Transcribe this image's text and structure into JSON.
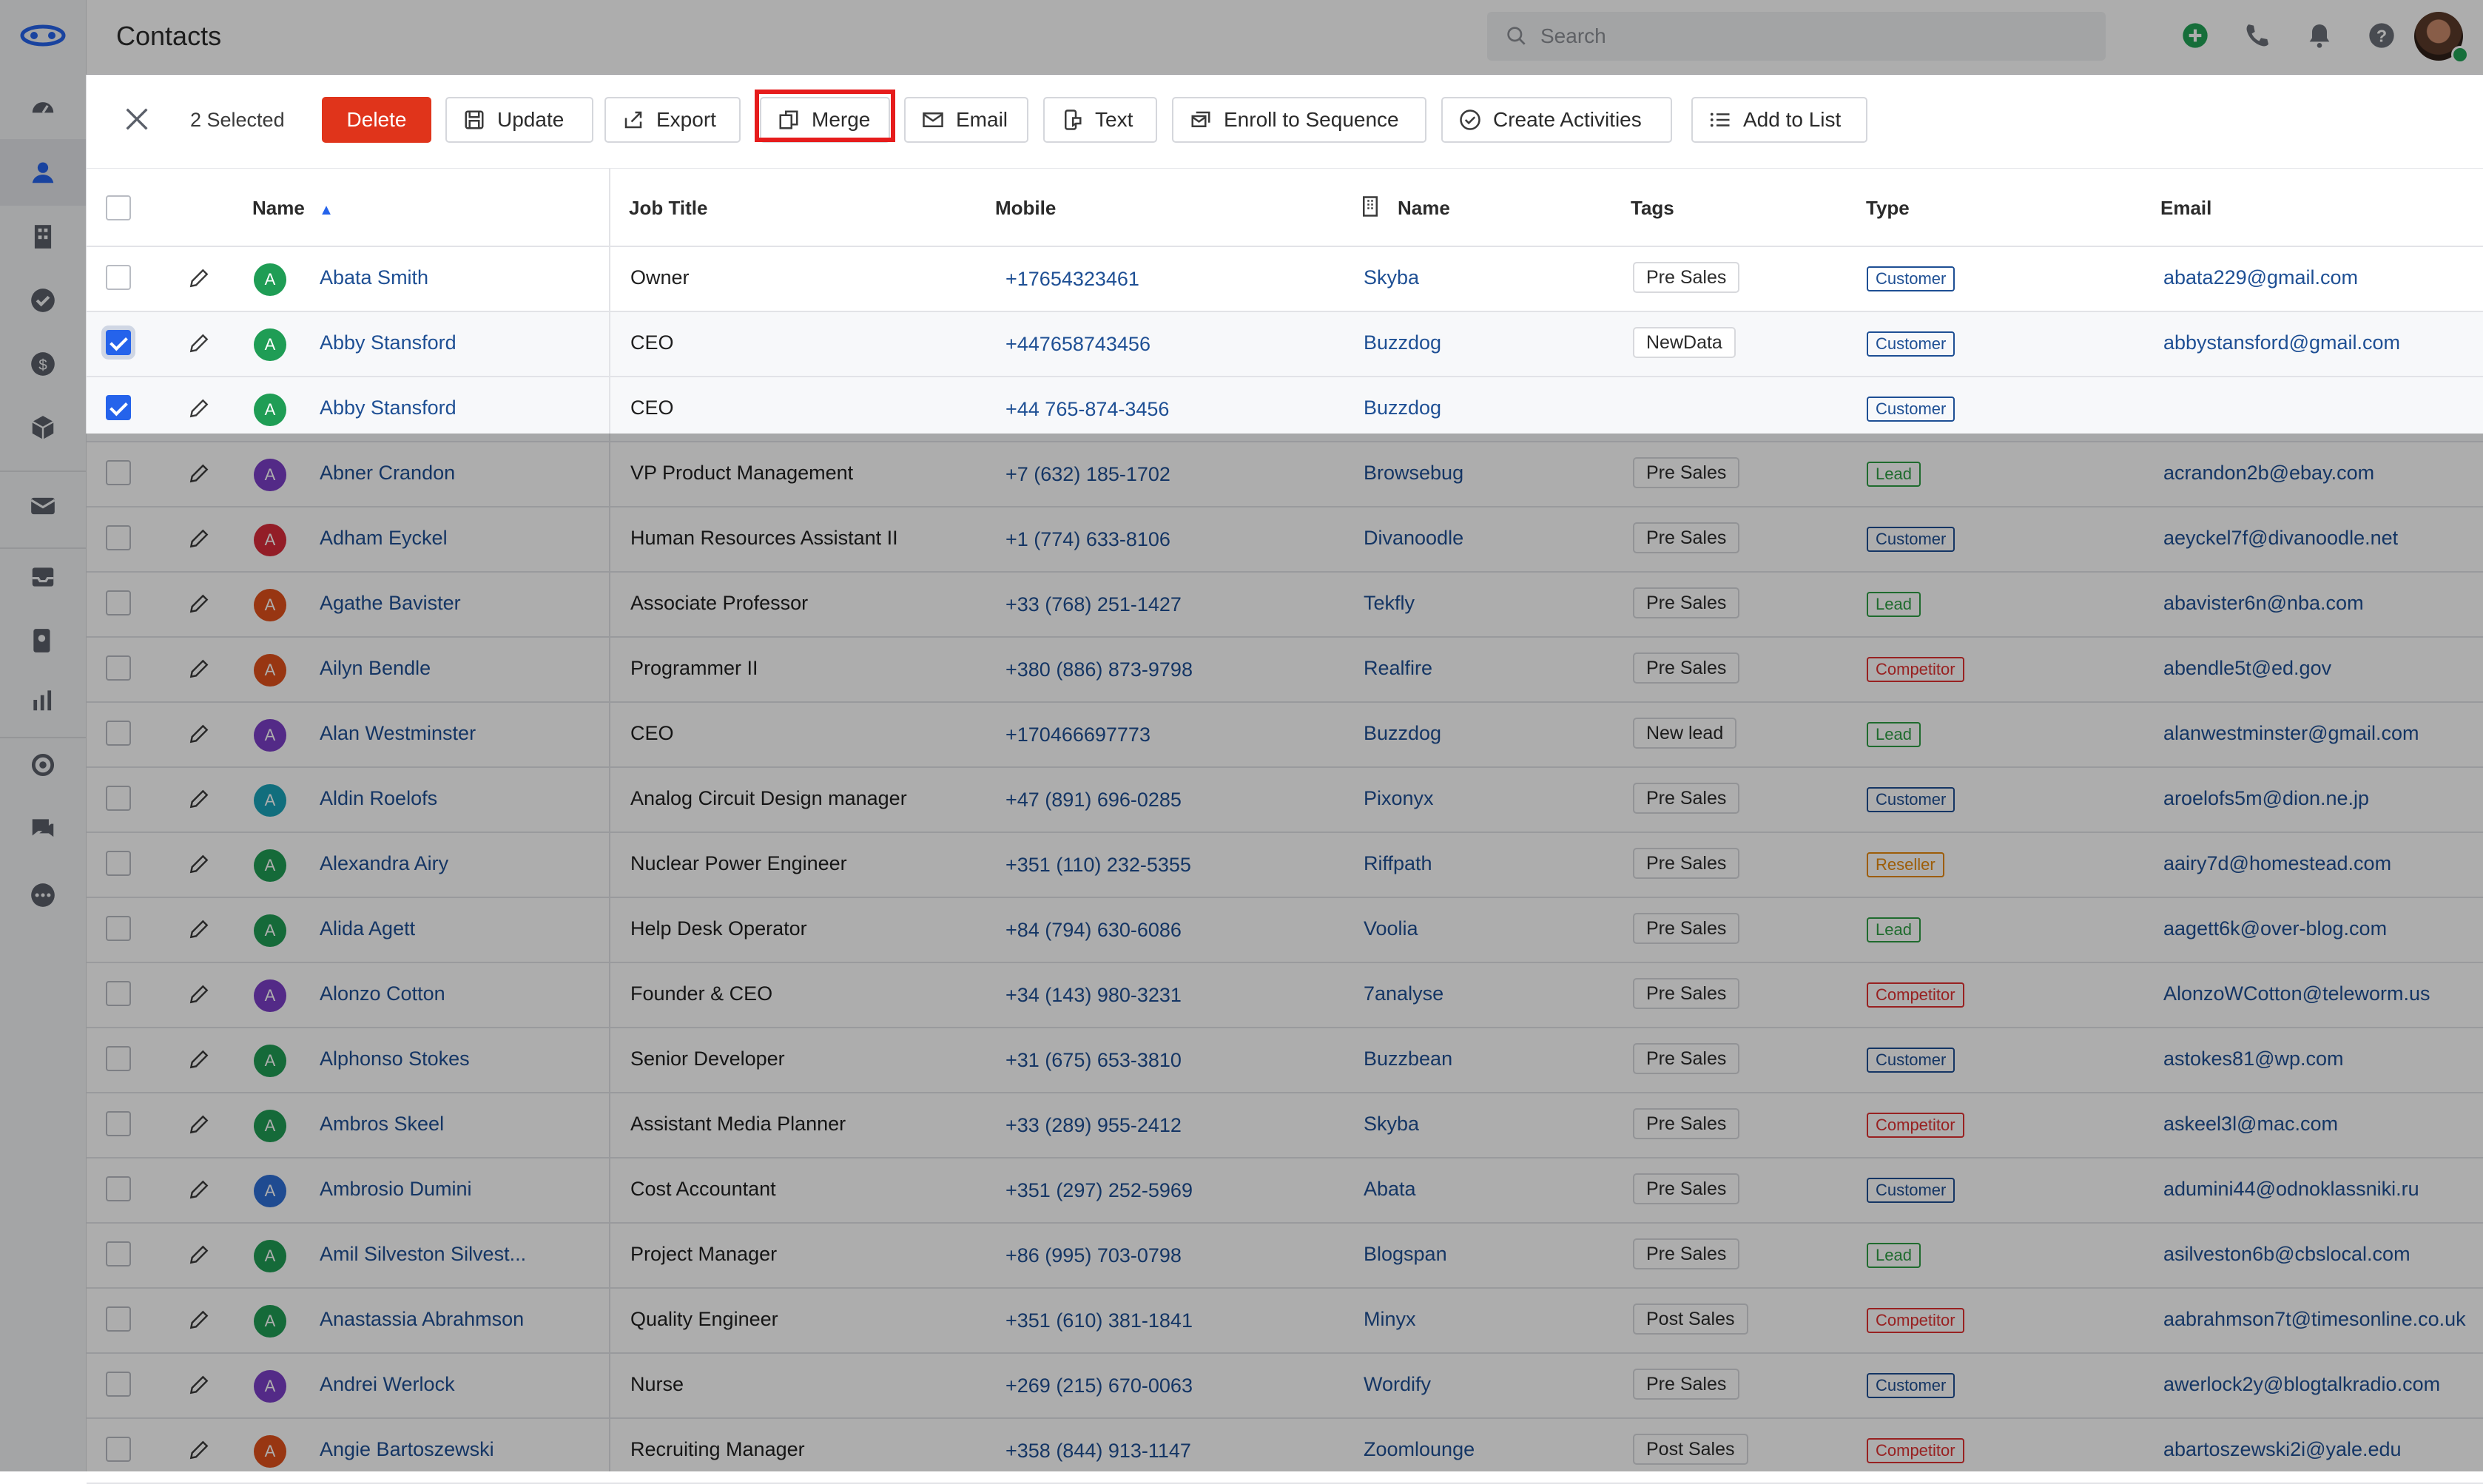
{
  "page": {
    "title": "Contacts"
  },
  "search": {
    "placeholder": "Search"
  },
  "actionbar": {
    "selected_label": "2 Selected",
    "buttons": {
      "delete": "Delete",
      "update": "Update",
      "export": "Export",
      "merge": "Merge",
      "email": "Email",
      "text": "Text",
      "enroll": "Enroll to Sequence",
      "create_activities": "Create Activities",
      "add_to_list": "Add to List"
    }
  },
  "table": {
    "headers": {
      "name": "Name",
      "job_title": "Job Title",
      "mobile": "Mobile",
      "company_name": "Name",
      "tags": "Tags",
      "type": "Type",
      "email": "Email"
    },
    "rows": [
      {
        "checked": false,
        "name": "Abata Smith",
        "avatar": "A",
        "avatar_color": "#1f9d55",
        "job": "Owner",
        "mobile": "+17654323461",
        "company": "Skyba",
        "tag": "Pre Sales",
        "type": "Customer",
        "email": "abata229@gmail.com"
      },
      {
        "checked": true,
        "name": "Abby Stansford",
        "avatar": "A",
        "avatar_color": "#1f9d55",
        "job": "CEO",
        "mobile": "+447658743456",
        "company": "Buzzdog",
        "tag": "NewData",
        "type": "Customer",
        "email": "abbystansford@gmail.com"
      },
      {
        "checked": true,
        "name": "Abby Stansford",
        "avatar": "A",
        "avatar_color": "#1f9d55",
        "job": "CEO",
        "mobile": "+44 765-874-3456",
        "company": "Buzzdog",
        "tag": "",
        "type": "Customer",
        "email": ""
      },
      {
        "checked": false,
        "name": "Abner Crandon",
        "avatar": "A",
        "avatar_color": "#7b3fc7",
        "job": "VP Product Management",
        "mobile": "+7 (632) 185-1702",
        "company": "Browsebug",
        "tag": "Pre Sales",
        "type": "Lead",
        "email": "acrandon2b@ebay.com"
      },
      {
        "checked": false,
        "name": "Adham Eyckel",
        "avatar": "A",
        "avatar_color": "#d92b3a",
        "job": "Human Resources Assistant II",
        "mobile": "+1 (774) 633-8106",
        "company": "Divanoodle",
        "tag": "Pre Sales",
        "type": "Customer",
        "email": "aeyckel7f@divanoodle.net"
      },
      {
        "checked": false,
        "name": "Agathe Bavister",
        "avatar": "A",
        "avatar_color": "#e0501b",
        "job": "Associate Professor",
        "mobile": "+33 (768) 251-1427",
        "company": "Tekfly",
        "tag": "Pre Sales",
        "type": "Lead",
        "email": "abavister6n@nba.com"
      },
      {
        "checked": false,
        "name": "Ailyn Bendle",
        "avatar": "A",
        "avatar_color": "#e0501b",
        "job": "Programmer II",
        "mobile": "+380 (886) 873-9798",
        "company": "Realfire",
        "tag": "Pre Sales",
        "type": "Competitor",
        "email": "abendle5t@ed.gov"
      },
      {
        "checked": false,
        "name": "Alan Westminster",
        "avatar": "A",
        "avatar_color": "#7b3fc7",
        "job": "CEO",
        "mobile": "+170466697773",
        "company": "Buzzdog",
        "tag": "New lead",
        "type": "Lead",
        "email": "alanwestminster@gmail.com"
      },
      {
        "checked": false,
        "name": "Aldin Roelofs",
        "avatar": "A",
        "avatar_color": "#1aa3b8",
        "job": "Analog Circuit Design manager",
        "mobile": "+47 (891) 696-0285",
        "company": "Pixonyx",
        "tag": "Pre Sales",
        "type": "Customer",
        "email": "aroelofs5m@dion.ne.jp"
      },
      {
        "checked": false,
        "name": "Alexandra Airy",
        "avatar": "A",
        "avatar_color": "#1f9d55",
        "job": "Nuclear Power Engineer",
        "mobile": "+351 (110) 232-5355",
        "company": "Riffpath",
        "tag": "Pre Sales",
        "type": "Reseller",
        "email": "aairy7d@homestead.com"
      },
      {
        "checked": false,
        "name": "Alida Agett",
        "avatar": "A",
        "avatar_color": "#1f9d55",
        "job": "Help Desk Operator",
        "mobile": "+84 (794) 630-6086",
        "company": "Voolia",
        "tag": "Pre Sales",
        "type": "Lead",
        "email": "aagett6k@over-blog.com"
      },
      {
        "checked": false,
        "name": "Alonzo Cotton",
        "avatar": "A",
        "avatar_color": "#7b3fc7",
        "job": "Founder & CEO",
        "mobile": "+34 (143) 980-3231",
        "company": "7analyse",
        "tag": "Pre Sales",
        "type": "Competitor",
        "email": "AlonzoWCotton@teleworm.us"
      },
      {
        "checked": false,
        "name": "Alphonso Stokes",
        "avatar": "A",
        "avatar_color": "#1f9d55",
        "job": "Senior Developer",
        "mobile": "+31 (675) 653-3810",
        "company": "Buzzbean",
        "tag": "Pre Sales",
        "type": "Customer",
        "email": "astokes81@wp.com"
      },
      {
        "checked": false,
        "name": "Ambros Skeel",
        "avatar": "A",
        "avatar_color": "#1f9d55",
        "job": "Assistant Media Planner",
        "mobile": "+33 (289) 955-2412",
        "company": "Skyba",
        "tag": "Pre Sales",
        "type": "Competitor",
        "email": "askeel3l@mac.com"
      },
      {
        "checked": false,
        "name": "Ambrosio Dumini",
        "avatar": "A",
        "avatar_color": "#2f6fd6",
        "job": "Cost Accountant",
        "mobile": "+351 (297) 252-5969",
        "company": "Abata",
        "tag": "Pre Sales",
        "type": "Customer",
        "email": "adumini44@odnoklassniki.ru"
      },
      {
        "checked": false,
        "name": "Amil Silveston Silvest...",
        "avatar": "A",
        "avatar_color": "#1f9d55",
        "job": "Project Manager",
        "mobile": "+86 (995) 703-0798",
        "company": "Blogspan",
        "tag": "Pre Sales",
        "type": "Lead",
        "email": "asilveston6b@cbslocal.com"
      },
      {
        "checked": false,
        "name": "Anastassia Abrahmson",
        "avatar": "A",
        "avatar_color": "#1f9d55",
        "job": "Quality Engineer",
        "mobile": "+351 (610) 381-1841",
        "company": "Minyx",
        "tag": "Post Sales",
        "type": "Competitor",
        "email": "aabrahmson7t@timesonline.co.uk"
      },
      {
        "checked": false,
        "name": "Andrei Werlock",
        "avatar": "A",
        "avatar_color": "#7b3fc7",
        "job": "Nurse",
        "mobile": "+269 (215) 670-0063",
        "company": "Wordify",
        "tag": "Pre Sales",
        "type": "Customer",
        "email": "awerlock2y@blogtalkradio.com"
      },
      {
        "checked": false,
        "name": "Angie Bartoszewski",
        "avatar": "A",
        "avatar_color": "#e0501b",
        "job": "Recruiting Manager",
        "mobile": "+358 (844) 913-1147",
        "company": "Zoomlounge",
        "tag": "Post Sales",
        "type": "Competitor",
        "email": "abartoszewski2i@yale.edu"
      }
    ]
  },
  "type_colors": {
    "Customer": "#1e4f94",
    "Lead": "#2f9e44",
    "Competitor": "#e03131",
    "Reseller": "#e8890c"
  }
}
